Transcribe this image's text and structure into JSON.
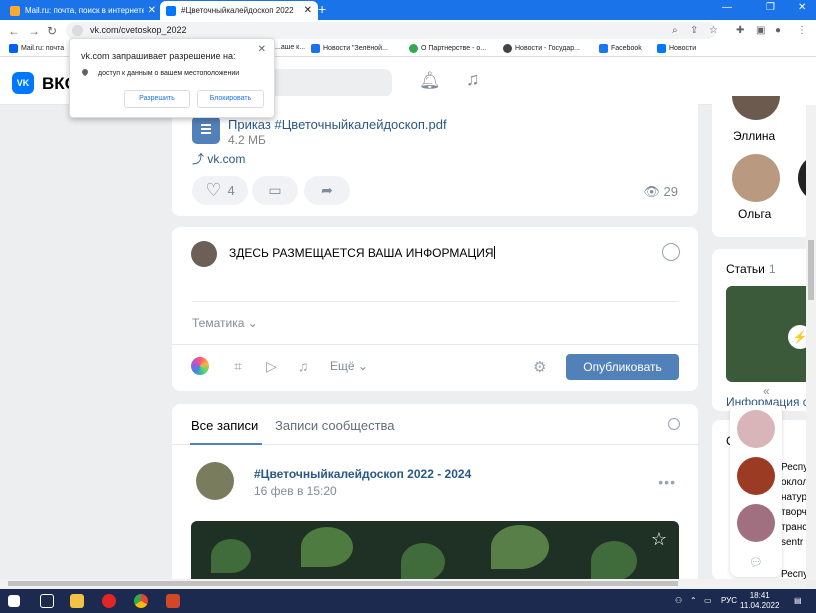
{
  "browser": {
    "tabs": [
      {
        "title": "Mail.ru: почта, поиск в интернете",
        "active": false
      },
      {
        "title": "#Цветочныйкалейдоскоп 2022",
        "active": true
      }
    ],
    "url": "vk.com/cvetoskop_2022",
    "bookmarks": [
      "Mail.ru: почта",
      "...аше к...",
      "Новости \"Зелёной...",
      "О Партнерстве - о...",
      "Новости - Государ...",
      "Facebook",
      "Новости"
    ]
  },
  "permission": {
    "title": "vk.com запрашивает разрешение на:",
    "item": "доступ к данным о вашем местоположении",
    "allow": "Разрешить",
    "block": "Блокировать"
  },
  "vk": {
    "logo": "VK",
    "name": "ВКО"
  },
  "doc_post": {
    "doc_title": "Приказ #Цветочныйкалейдоскоп.pdf",
    "doc_size": "4.2 МБ",
    "link": "vk.com",
    "likes": "4",
    "views": "29"
  },
  "composer": {
    "text": "ЗДЕСЬ РАЗМЕЩАЕТСЯ ВАША ИНФОРМАЦИЯ",
    "topic": "Тематика",
    "more": "Ещё",
    "publish": "Опубликовать"
  },
  "feed": {
    "tab_all": "Все записи",
    "tab_community": "Записи сообщества",
    "post_title": "#Цветочныйкалейдоскоп 2022 - 2024",
    "post_date": "16 фев в 15:20"
  },
  "right": {
    "people": [
      "Эллина",
      "Ольга"
    ],
    "articles_label": "Статьи",
    "articles_count": "1",
    "article_title": "Информация с",
    "letter": "С",
    "snippets": [
      "Респу",
      "оклол",
      "натур",
      "творч",
      "транс",
      "sentr",
      "Респу"
    ]
  },
  "taskbar": {
    "lang": "РУС",
    "time": "18:41",
    "date": "11.04.2022"
  }
}
